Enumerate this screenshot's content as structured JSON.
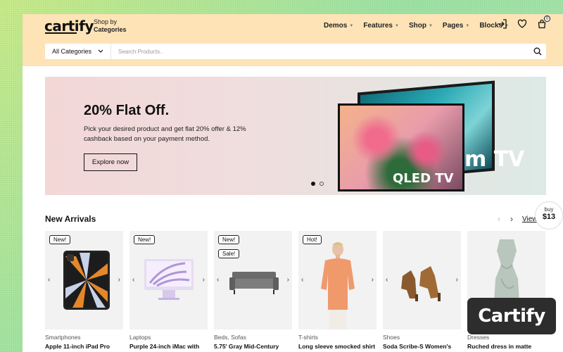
{
  "header": {
    "logo": "cartify",
    "shop_by_line1": "Shop by",
    "shop_by_line2": "Categories",
    "nav": [
      "Demos",
      "Features",
      "Shop",
      "Pages",
      "Blocks"
    ],
    "cart_count": "0",
    "icons": [
      "login-icon",
      "heart-icon",
      "bag-icon"
    ]
  },
  "search": {
    "category": "All Categories",
    "placeholder": "Search Products.."
  },
  "hero": {
    "title": "20% Flat Off.",
    "text": "Pick your desired product and get flat 20% offer & 12% cashback based on your payment method.",
    "button": "Explore now",
    "tv_front_label": "QLED TV",
    "tv_back_label": "m TV",
    "slides": 2,
    "active_slide": 1
  },
  "arrivals": {
    "title": "New Arrivals",
    "view_all": "View",
    "buy_label": "buy",
    "buy_price": "$13",
    "products": [
      {
        "tags": [
          "New!"
        ],
        "category": "Smartphones",
        "name": "Apple 11-inch iPad Pro"
      },
      {
        "tags": [
          "New!"
        ],
        "category": "Laptops",
        "name": "Purple 24-inch iMac with"
      },
      {
        "tags": [
          "New!",
          "Sale!"
        ],
        "category": "Beds, Sofas",
        "name": "5.75' Gray Mid-Century"
      },
      {
        "tags": [
          "Hot!"
        ],
        "category": "T-shirts",
        "name": "Long sleeve smocked shirt"
      },
      {
        "tags": [],
        "category": "Shoes",
        "name": "Soda Scribe-S Women's"
      },
      {
        "tags": [],
        "category": "Dresses",
        "name": "Ruched dress in matte"
      }
    ]
  },
  "brand_badge": "Cartify"
}
